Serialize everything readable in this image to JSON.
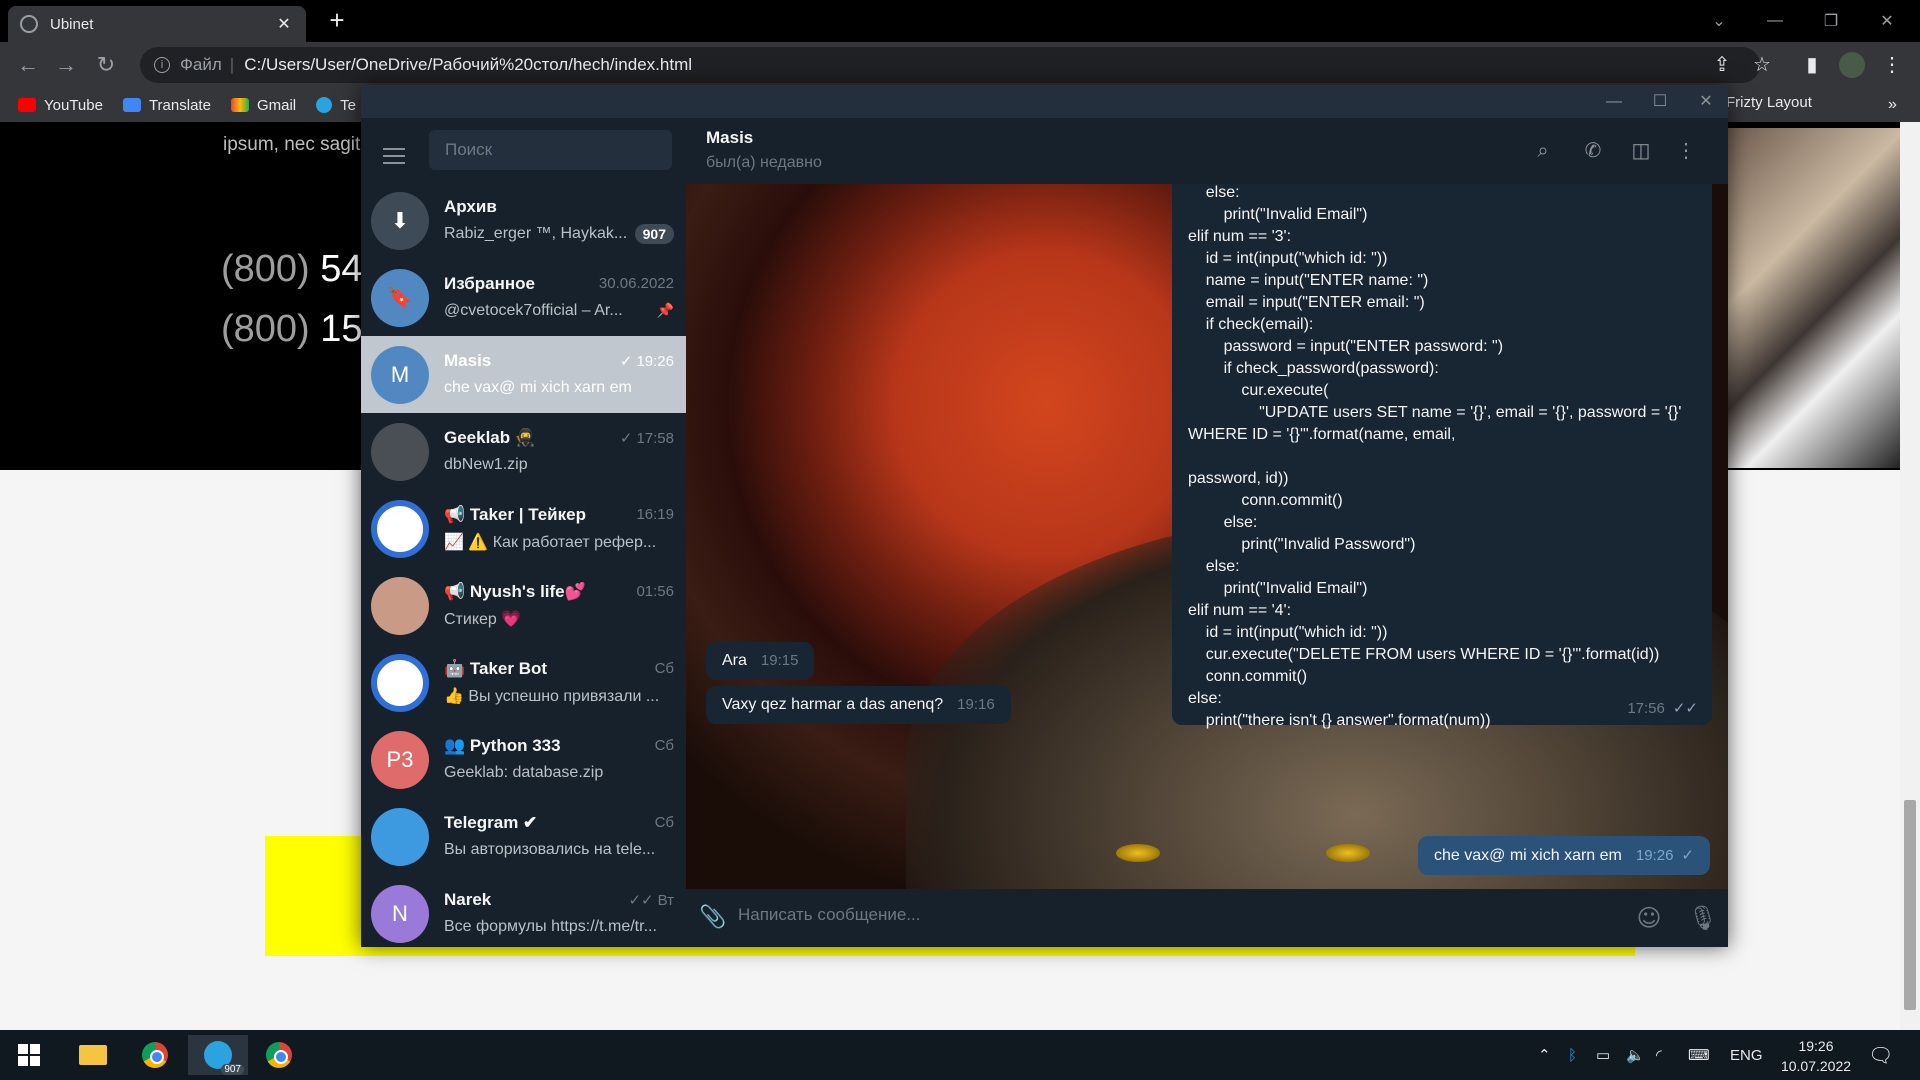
{
  "browser": {
    "tab_title": "Ubinet",
    "url_scheme": "Файл",
    "url": "C:/Users/User/OneDrive/Рабочий%20стол/hech/index.html",
    "bookmarks": [
      "YouTube",
      "Translate",
      "Gmail",
      "Te"
    ],
    "bookmark_right": "Frizty Layout",
    "more_bookmarks": "»"
  },
  "webpage": {
    "lorem": "ipsum, nec sagit",
    "phone1_prefix": "(800)",
    "phone1_rest": "54",
    "phone2_prefix": "(800)",
    "phone2_rest": "15"
  },
  "telegram": {
    "search_placeholder": "Поиск",
    "chats": [
      {
        "name": "Архив",
        "preview": "Rabiz_erger ™, Haykak...",
        "time": "",
        "badge": "907",
        "avatar_text": "",
        "avatar_color": "#3e4a55",
        "icon": "archive-icon"
      },
      {
        "name": "Избранное",
        "preview": "@cvetocek7official – Ar...",
        "time": "30.06.2022",
        "badge": "",
        "avatar_text": "",
        "avatar_color": "#5288c1",
        "icon": "bookmark-icon"
      },
      {
        "name": "Masis",
        "preview": "che vax@ mi xich xarn em",
        "time": "19:26",
        "badge": "",
        "avatar_text": "M",
        "avatar_color": "#5288c1",
        "check": "✓"
      },
      {
        "name": "Geeklab 🥷",
        "preview": "dbNew1.zip",
        "time": "17:58",
        "badge": "",
        "avatar_text": "",
        "avatar_color": "#4a4f55",
        "check": "✓"
      },
      {
        "name": "📢 Taker | Тейкер",
        "preview": "📈 ⚠️ Как работает рефер...",
        "time": "16:19",
        "badge": "",
        "avatar_text": "",
        "avatar_color": "#ffffff"
      },
      {
        "name": "📢 Nyush's life💕",
        "preview": "Стикер 💗",
        "time": "01:56",
        "badge": "",
        "avatar_text": "",
        "avatar_color": "#c99a86"
      },
      {
        "name": "🤖 Taker Bot",
        "preview": "👍 Вы успешно привязали ...",
        "time": "Сб",
        "badge": "",
        "avatar_text": "",
        "avatar_color": "#ffffff"
      },
      {
        "name": "👥 Python 333",
        "preview": "Geeklab: database.zip",
        "time": "Сб",
        "badge": "",
        "avatar_text": "P3",
        "avatar_color": "#e06b6b"
      },
      {
        "name": "Telegram ✔",
        "preview": "Вы авторизовались на tele...",
        "time": "Сб",
        "badge": "",
        "avatar_text": "",
        "avatar_color": "#3d9ae0"
      },
      {
        "name": "Narek",
        "preview": "Все формулы https://t.me/tr...",
        "time": "Вт",
        "badge": "",
        "avatar_text": "N",
        "avatar_color": "#9a7ad8",
        "check": "✓✓"
      }
    ],
    "conversation": {
      "name": "Masis",
      "status": "был(а) недавно",
      "code_message": "    else:\n        print(\"Invalid Email\")\nelif num == '3':\n    id = int(input(\"which id: \"))\n    name = input(\"ENTER name: \")\n    email = input(\"ENTER email: \")\n    if check(email):\n        password = input(\"ENTER password: \")\n        if check_password(password):\n            cur.execute(\n                \"UPDATE users SET name = '{}', email = '{}', password = '{}' WHERE ID = '{}'\".format(name, email,\n                                                                                                              password, id))\n            conn.commit()\n        else:\n            print(\"Invalid Password\")\n    else:\n        print(\"Invalid Email\")\nelif num == '4':\n    id = int(input(\"which id: \"))\n    cur.execute(\"DELETE FROM users WHERE ID = '{}'\".format(id))\n    conn.commit()\nelse:\n    print(\"there isn't {} answer\".format(num))",
      "code_time": "17:56",
      "messages": [
        {
          "text": "Ara",
          "time": "19:15"
        },
        {
          "text": "Vaxy qez harmar a das anenq?",
          "time": "19:16"
        },
        {
          "text": "che vax@ mi xich xarn em",
          "time": "19:26",
          "check": "✓"
        }
      ],
      "composer_placeholder": "Написать сообщение..."
    }
  },
  "taskbar": {
    "telegram_badge": "907",
    "lang": "ENG",
    "time": "19:26",
    "date": "10.07.2022"
  }
}
